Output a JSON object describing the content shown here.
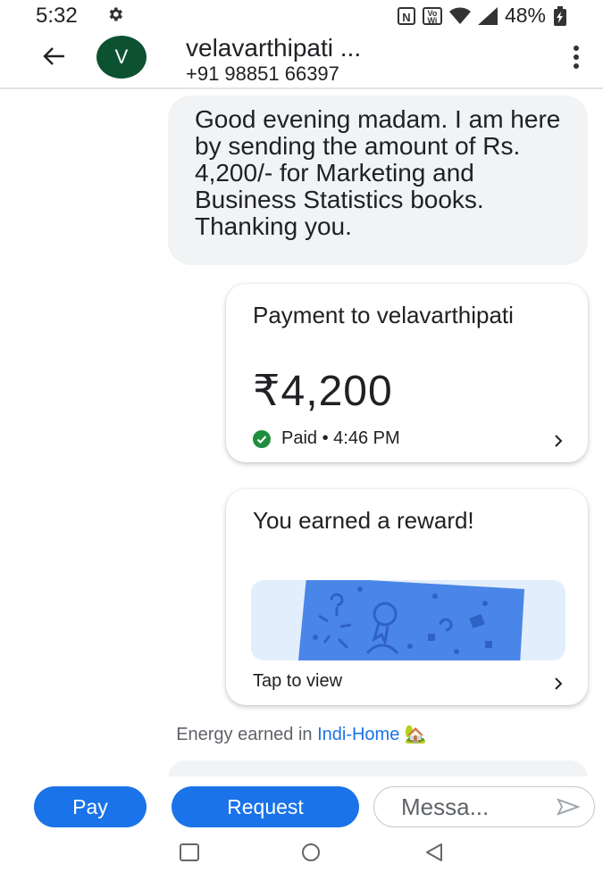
{
  "status_bar": {
    "time": "5:32",
    "battery_percent": "48%",
    "icons": [
      "gear-icon",
      "nfc-icon",
      "volte-wifi-icon",
      "wifi-icon",
      "signal-icon",
      "battery-icon"
    ]
  },
  "header": {
    "avatar_letter": "V",
    "contact_name": "velavarthipati ...",
    "contact_phone": "+91 98851 66397"
  },
  "message": {
    "text": "Good evening madam. I am here by sending the amount of Rs. 4,200/- for Marketing and Business Statistics books. Thanking you."
  },
  "payment_card": {
    "title": "Payment to velavarthipati",
    "amount": "₹4,200",
    "status": "Paid • 4:46 PM"
  },
  "reward_card": {
    "title": "You earned a reward!",
    "action": "Tap to view"
  },
  "energy": {
    "prefix": "Energy earned in",
    "link": "Indi-Home",
    "emoji": "🏡"
  },
  "composer": {
    "pay_label": "Pay",
    "request_label": "Request",
    "message_placeholder": "Messa..."
  },
  "colors": {
    "accent": "#1a73e8",
    "avatar": "#0c5130",
    "success": "#1e8e3e",
    "bubble": "#f1f3f4",
    "reward_art": "#4a86e8"
  }
}
